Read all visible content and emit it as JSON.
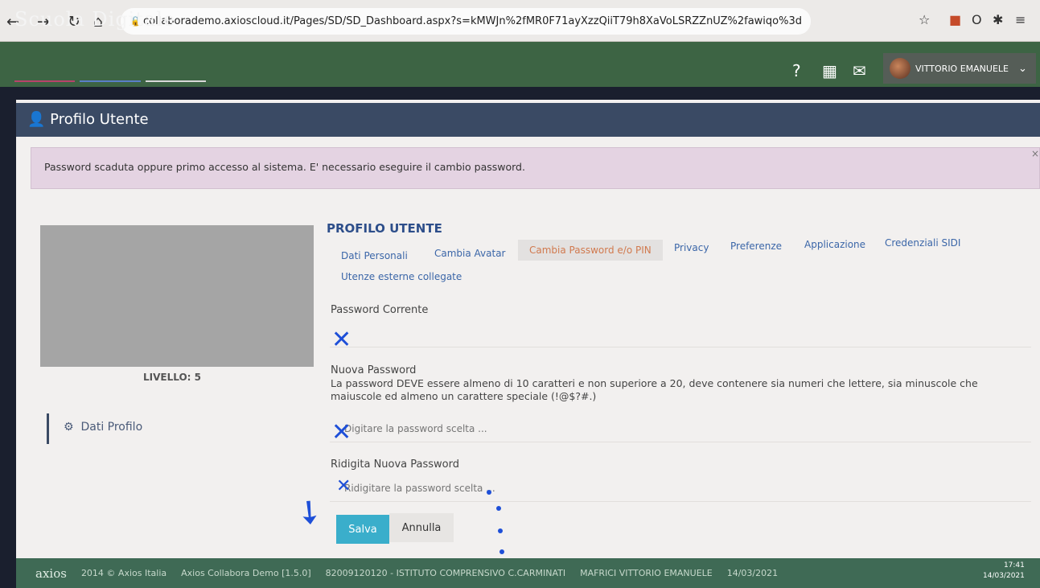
{
  "browser": {
    "url": "collaborademo.axioscloud.it/Pages/SD/SD_Dashboard.aspx?s=kMWJn%2fMR0F71ayXzzQiiT79h8XaVoLSRZZnUZ%2fawiqo%3d"
  },
  "header": {
    "brand": "Scuola Digitale",
    "user_name": "VITTORIO EMANUELE"
  },
  "page": {
    "title": "Profilo Utente",
    "alert": "Password scaduta oppure primo accesso al sistema. E' necessario eseguire il cambio password.",
    "alert_close": "×"
  },
  "sidebar": {
    "level": "LIVELLO: 5",
    "menu_item": "Dati Profilo"
  },
  "profile": {
    "section_title": "PROFILO UTENTE",
    "tabs": [
      {
        "label": "Dati Personali"
      },
      {
        "label": "Cambia Avatar"
      },
      {
        "label": "Cambia Password e/o PIN",
        "active": true
      },
      {
        "label": "Privacy"
      },
      {
        "label": "Preferenze"
      },
      {
        "label": "Applicazione"
      },
      {
        "label": "Credenziali SIDI"
      },
      {
        "label": "Utenze esterne collegate"
      }
    ],
    "current_password_label": "Password Corrente",
    "new_password_label": "Nuova Password",
    "new_password_hint": "La password DEVE essere almeno di 10 caratteri e non superiore a 20, deve contenere sia numeri che lettere, sia minuscole che maiuscole ed almeno un carattere speciale (!@$?#.)",
    "new_password_placeholder": "Digitare la password scelta ...",
    "retype_password_label": "Ridigita Nuova Password",
    "retype_password_placeholder": "Ridigitare la password scelta ...",
    "save_label": "Salva",
    "cancel_label": "Annulla"
  },
  "footer": {
    "logo": "axios",
    "copyright": "2014 © Axios Italia",
    "app_version": "Axios Collabora Demo [1.5.0]",
    "institute": "82009120120 - ISTITUTO COMPRENSIVO C.CARMINATI",
    "user": "MAFRICI VITTORIO EMANUELE",
    "date": "14/03/2021"
  },
  "taskbar": {
    "time": "17:41",
    "date": "14/03/2021"
  },
  "colors": {
    "header_green": "#3d6444",
    "title_bar": "#3a4a64",
    "alert_bg": "#e4d3e2",
    "save_button": "#3aaecb",
    "active_tab_text": "#d17a4f"
  }
}
